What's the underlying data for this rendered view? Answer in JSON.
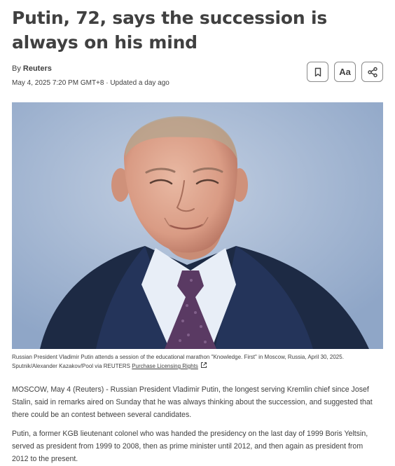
{
  "article": {
    "headline": "Putin, 72, says the succession is always on his mind",
    "byline_prefix": "By ",
    "author": "Reuters",
    "dateline": "May 4, 2025 7:20 PM GMT+8 · Updated a day ago"
  },
  "toolbar": {
    "bookmark_icon": "bookmark-icon",
    "text_size_label": "Aa",
    "share_icon": "share-icon"
  },
  "image": {
    "caption": "Russian President Vladimir Putin attends a session of the educational marathon \"Knowledge. First\" in Moscow, Russia, April 30, 2025. Sputnik/Alexander Kazakov/Pool via REUTERS ",
    "licensing_link": "Purchase Licensing Rights",
    "external_icon": "external-link-icon"
  },
  "body": {
    "paragraphs": [
      "MOSCOW, May 4 (Reuters) - Russian President Vladimir Putin, the longest serving Kremlin chief since Josef Stalin, said in remarks aired on Sunday that he was always thinking about the succession, and suggested that there could be an contest between several candidates.",
      "Putin, a former KGB lieutenant colonel who was handed the presidency on the last day of 1999 Boris Yeltsin, served as president from 1999 to 2008, then as prime minister until 2012, and then again as president from 2012 to the present."
    ]
  },
  "colors": {
    "text": "#404040",
    "background": "#ffffff",
    "photo_backdrop": "#a9bbd6"
  }
}
